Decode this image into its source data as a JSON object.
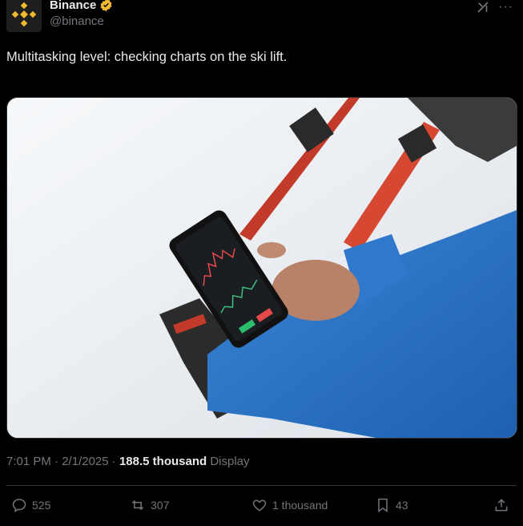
{
  "author": {
    "name": "Binance",
    "handle": "@binance",
    "verified_icon": "verified-badge-icon",
    "avatar_icon": "binance-logo-icon",
    "brand_color": "#F3BA2F"
  },
  "tweet": {
    "text": "Multitasking level: checking charts on the ski lift.",
    "time": "7:01 PM",
    "separator1": " · ",
    "date": "2/1/2025",
    "separator2": " · ",
    "views": "188.5 thousand",
    "views_label": " Display"
  },
  "actions": {
    "replies": "525",
    "reposts": "307",
    "likes": "1 thousand",
    "bookmarks": "43",
    "icons": [
      "reply-icon",
      "repost-icon",
      "like-icon",
      "bookmark-icon",
      "share-icon"
    ]
  },
  "header_icons": [
    "grok-icon",
    "more-icon"
  ],
  "media": {
    "description_icon": "photo-skier-phone"
  }
}
